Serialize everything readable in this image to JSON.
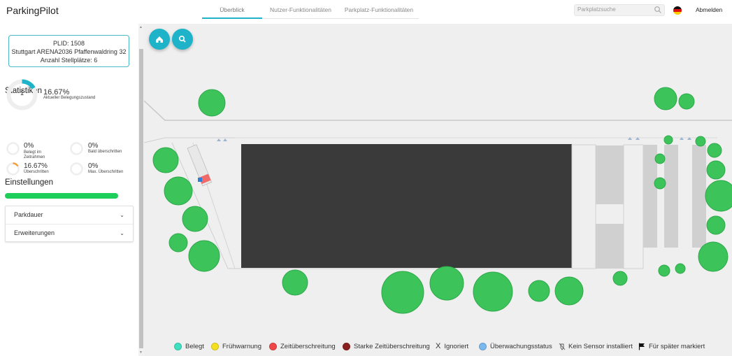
{
  "app": {
    "title": "ParkingPilot"
  },
  "tabs": [
    {
      "label": "Überblick",
      "active": true
    },
    {
      "label": "Nutzer-Funktionalitäten",
      "active": false
    },
    {
      "label": "Parkplatz-Funktionalitäten",
      "active": false
    }
  ],
  "search": {
    "placeholder": "Parkplatzsuche",
    "icon": "search-icon"
  },
  "language": {
    "icon": "flag-de-icon"
  },
  "logout_label": "Abmelden",
  "lot": {
    "plid_line": "PLID: 1508",
    "address_line": "Stuttgart ARENA2036 Pfaffenwaldring 32",
    "spots_line": "Anzahl Stellplätze: 6"
  },
  "stats": {
    "heading": "Statistiken",
    "main": {
      "count": "1",
      "percent": "16.67%",
      "label": "Aktueller Belegungszustand",
      "fraction": 0.1667,
      "color": "#1fb3c9"
    },
    "items": [
      {
        "percent": "0%",
        "label": "Belegt im Zeitrahmen",
        "fraction": 0
      },
      {
        "percent": "0%",
        "label": "Bald überschritten",
        "fraction": 0
      },
      {
        "percent": "16.67%",
        "label": "Überschritten",
        "fraction": 0.1667,
        "color": "#f0a040"
      },
      {
        "percent": "0%",
        "label": "Max. Überschritten",
        "fraction": 0
      }
    ]
  },
  "settings": {
    "heading": "Einstellungen",
    "progress_fraction": 1.0,
    "progress_color": "#1ece5a",
    "sections": [
      {
        "label": "Parkdauer"
      },
      {
        "label": "Erweiterungen"
      }
    ]
  },
  "map_buttons": [
    {
      "icon": "home-icon"
    },
    {
      "icon": "search-icon"
    }
  ],
  "legend": [
    {
      "label": "Belegt",
      "color": "#3de0c0",
      "icon": "dot"
    },
    {
      "label": "Frühwarnung",
      "color": "#f5e020",
      "icon": "dot"
    },
    {
      "label": "Zeitüberschreitung",
      "color": "#f04848",
      "icon": "dot"
    },
    {
      "label": "Starke Zeitüberschreitung",
      "color": "#8a1f1f",
      "icon": "dot"
    },
    {
      "label": "Ignoriert",
      "icon": "x-icon"
    },
    {
      "label": "Überwachungsstatus",
      "color": "#7ab8f0",
      "icon": "dot"
    },
    {
      "label": "Kein Sensor installiert",
      "icon": "no-sensor-icon"
    },
    {
      "label": "Für später markiert",
      "icon": "flag-icon"
    }
  ],
  "colors": {
    "accent": "#1fb3c9",
    "building": "#3a3a3a",
    "tree": "#3cc45a",
    "map_bg": "#efefef"
  }
}
